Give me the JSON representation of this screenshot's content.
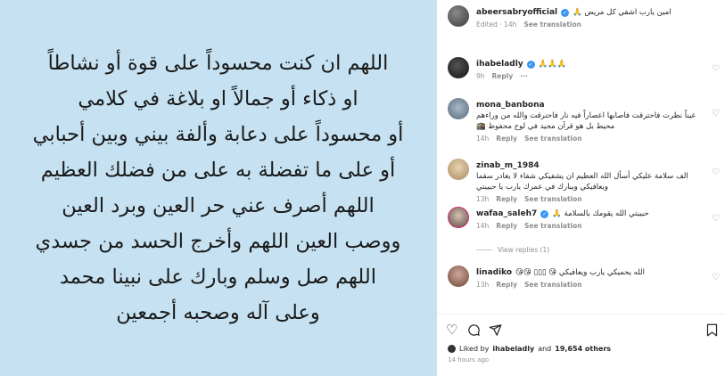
{
  "image_text": {
    "lines": [
      "اللهم ان كنت محسوداً على قوة أو نشاطاً",
      "او ذكاء أو جمالاً او بلاغة في كلامي",
      "أو محسوداً على دعابة وألفة بيني وبين أحبابي",
      "أو على ما تفضلة به على من فضلك العظيم",
      "اللهم أصرف عني حر العين وبرد العين",
      "ووصب العين اللهم وأخرج الحسد من جسدي",
      "اللهم صل وسلم وبارك على نبينا محمد",
      "وعلى آله وصحبه أجمعين"
    ]
  },
  "comments": [
    {
      "username": "abeersabryofficial",
      "verified": true,
      "text": "امين يارب اشفي كل مريض 🙏",
      "meta": [
        "Edited · 14h",
        "See translation"
      ],
      "avatar": "avatar-icon"
    },
    {
      "username": "ihabeladly",
      "verified": true,
      "text": "🙏🙏🙏",
      "meta": [
        "9h",
        "Reply",
        "···"
      ],
      "avatar": "avatar-icon"
    },
    {
      "username": "mona_banbona",
      "verified": false,
      "text": "عيناً نظرت فاحترقت فاصابها اعصاراً فيه نار فاحترقت والله من وراءهم محيط بل هو قرآن مجيد في لوح محفوظ 🕋",
      "meta": [
        "14h",
        "Reply",
        "See translation"
      ],
      "avatar": "avatar-icon"
    },
    {
      "username": "zinab_m_1984",
      "verified": false,
      "text": "الف سلامة عليكي أسأل الله العظيم ان يشفيكي شفاء لا يغادر سقما ويعافيكي ويبارك في عمرك يارب يا حبيبتي",
      "meta": [
        "13h",
        "Reply",
        "See translation"
      ],
      "avatar": "avatar-icon"
    },
    {
      "username": "wafaa_saleh7",
      "verified": true,
      "text": "حبيبتي الله يقومك بالسلامة 🙏",
      "meta": [
        "14h",
        "Reply",
        "See translation"
      ],
      "avatar": "avatar-icon",
      "view_replies": "View replies (1)"
    },
    {
      "username": "linadiko",
      "verified": false,
      "text": "الله يحميكي يارب ويعافيكي 😘 ▯▯▯ 😘😘",
      "meta": [
        "13h",
        "Reply",
        "See translation"
      ],
      "avatar": "avatar-icon"
    }
  ],
  "actions": {
    "like_icon": "heart-icon",
    "comment_icon": "comment-icon",
    "share_icon": "send-icon",
    "save_icon": "bookmark-icon"
  },
  "likes": {
    "prefix": "Liked by",
    "user": "ihabeladly",
    "connector": "and",
    "count": "19,654 others"
  },
  "timestamp": "14 hours ago",
  "colors": {
    "image_background": "#c6e2f2",
    "verified": "#3897f0",
    "muted": "#8e8e8e"
  }
}
